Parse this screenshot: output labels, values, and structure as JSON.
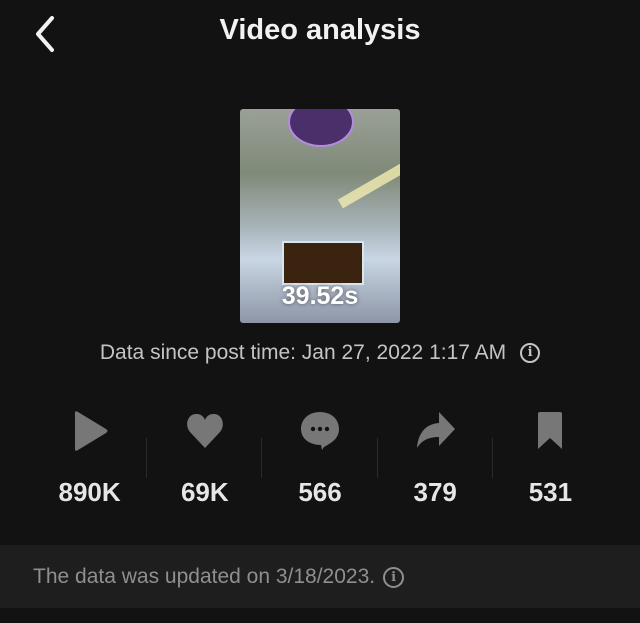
{
  "header": {
    "title": "Video analysis",
    "back_icon": "chevron-left-icon"
  },
  "video": {
    "duration": "39.52s"
  },
  "post_info": {
    "text": "Data since post time: Jan 27, 2022 1:17 AM",
    "info_icon": "i"
  },
  "stats": [
    {
      "icon": "play-icon",
      "value": "890K"
    },
    {
      "icon": "heart-icon",
      "value": "69K"
    },
    {
      "icon": "comment-icon",
      "value": "566"
    },
    {
      "icon": "share-icon",
      "value": "379"
    },
    {
      "icon": "bookmark-icon",
      "value": "531"
    }
  ],
  "banner": {
    "text": "The data was updated on 3/18/2023.",
    "info_icon": "i"
  },
  "colors": {
    "background": "#121212",
    "icon": "#777777",
    "banner": "#1e1e1e"
  }
}
